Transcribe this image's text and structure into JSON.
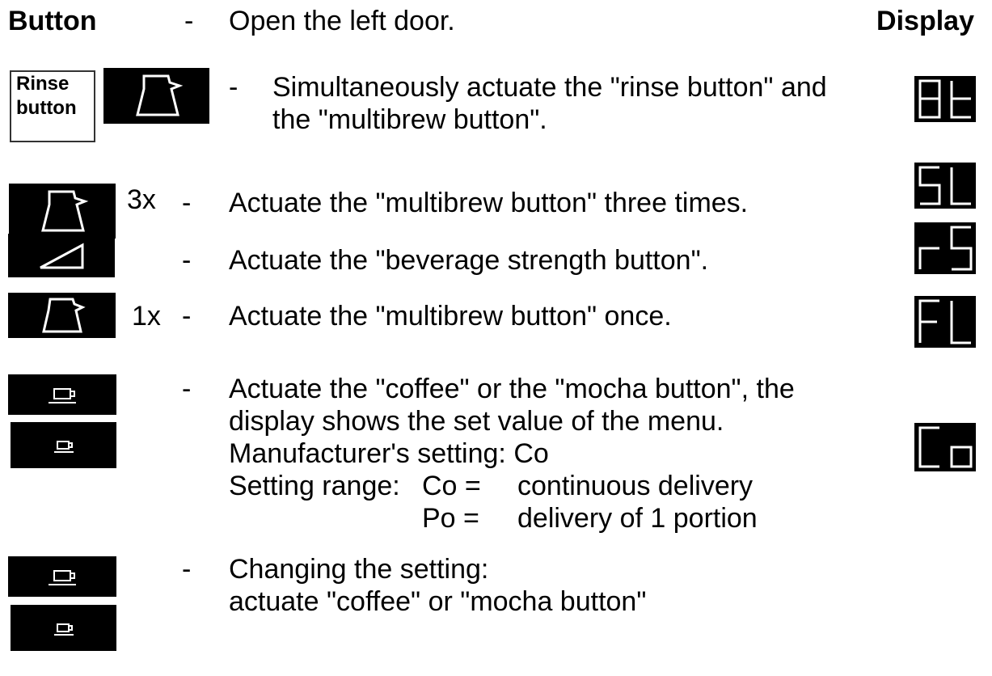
{
  "header": {
    "button_label": "Button",
    "dash": "-",
    "intro": "Open the left door.",
    "display_label": "Display"
  },
  "steps": [
    {
      "dash": "-",
      "lines": [
        "Simultaneously actuate the \"rinse button\" and",
        "the \"multibrew button\"."
      ],
      "rinse_label": [
        "Rinse",
        "button"
      ],
      "buttons": [
        "jug-icon"
      ],
      "display": "8t"
    },
    {
      "dash": "-",
      "count": "3x",
      "lines": [
        "Actuate the  \"multibrew button\" three times."
      ],
      "buttons": [
        "jug-icon"
      ],
      "display": "SL"
    },
    {
      "dash": "-",
      "lines": [
        "Actuate the \"beverage strength button\"."
      ],
      "buttons": [
        "wedge-icon"
      ],
      "display": "rS"
    },
    {
      "dash": "-",
      "count": "1x",
      "lines": [
        "Actuate the \"multibrew button\" once."
      ],
      "buttons": [
        "jug-icon"
      ],
      "display": "FL"
    },
    {
      "dash": "-",
      "lines": [
        "Actuate the \"coffee\" or the \"mocha button\", the",
        "display shows the set value of the menu.",
        "Manufacturer's setting: Co"
      ],
      "range_label": "Setting range:",
      "range": [
        {
          "code": "Co =",
          "text": "continuous delivery"
        },
        {
          "code": "Po =",
          "text": "delivery of 1 portion"
        }
      ],
      "buttons": [
        "coffee-cup-icon",
        "mocha-cup-icon"
      ],
      "display": "Co"
    },
    {
      "dash": "-",
      "lines": [
        "Changing the setting:",
        "actuate \"coffee\" or \"mocha button\""
      ],
      "buttons": [
        "coffee-cup-icon",
        "mocha-cup-icon"
      ]
    }
  ],
  "colors": {
    "key_bg": "#000000",
    "key_fg": "#ffffff",
    "display_bg": "#000000",
    "display_segment": "#ffffff"
  }
}
